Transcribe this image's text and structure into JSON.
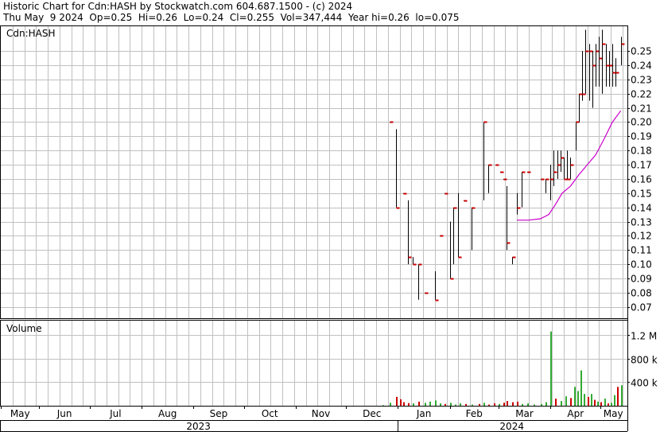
{
  "header": {
    "line1": "Historic Chart for Cdn:HASH by Stockwatch.com 604.687.1500 - (c) 2024",
    "line2": "Thu May  9 2024  Op=0.25  Hi=0.26  Lo=0.24  Cl=0.255  Vol=347,444  Year hi=0.26  lo=0.075"
  },
  "colors": {
    "background": "#ffffff",
    "grid": "#c0c0c0",
    "frame": "#000000",
    "bar_up": "#000000",
    "bar_close_tick": "#cc0000",
    "moving_average": "#cc00cc",
    "volume_up": "#33aa33",
    "volume_down": "#cc0000"
  },
  "chart_data": [
    {
      "type": "ohlc",
      "title": "Cdn:HASH",
      "y_ticks": [
        "0.25",
        "0.24",
        "0.23",
        "0.22",
        "0.21",
        "0.20",
        "0.19",
        "0.18",
        "0.17",
        "0.16",
        "0.15",
        "0.14",
        "0.13",
        "0.12",
        "0.11",
        "0.10",
        "0.09",
        "0.08",
        "0.07"
      ],
      "ylim": [
        0.062,
        0.268
      ],
      "x_labels": [
        "May",
        "Jun",
        "Jul",
        "Aug",
        "Sep",
        "Oct",
        "Nov",
        "Dec",
        "Jan",
        "Feb",
        "Mar",
        "Apr",
        "May"
      ],
      "year_labels": [
        "2023",
        "2024"
      ],
      "grid": true,
      "legend": "none",
      "ohlc": [
        {
          "d": 232,
          "h": 0.2,
          "l": 0.2,
          "c": 0.2
        },
        {
          "d": 236,
          "h": 0.195,
          "l": 0.14,
          "c": 0.14
        },
        {
          "d": 240,
          "h": 0.15,
          "l": 0.15,
          "c": 0.15
        },
        {
          "d": 243,
          "h": 0.145,
          "l": 0.1,
          "c": 0.105
        },
        {
          "d": 246,
          "h": 0.105,
          "l": 0.1,
          "c": 0.1
        },
        {
          "d": 249,
          "h": 0.1,
          "l": 0.075,
          "c": 0.1
        },
        {
          "d": 253,
          "h": 0.08,
          "l": 0.08,
          "c": 0.08
        },
        {
          "d": 259,
          "h": 0.095,
          "l": 0.075,
          "c": 0.075
        },
        {
          "d": 262,
          "h": 0.12,
          "l": 0.12,
          "c": 0.12
        },
        {
          "d": 265,
          "h": 0.15,
          "l": 0.15,
          "c": 0.15
        },
        {
          "d": 268,
          "h": 0.13,
          "l": 0.09,
          "c": 0.09
        },
        {
          "d": 270,
          "h": 0.14,
          "l": 0.1,
          "c": 0.14
        },
        {
          "d": 273,
          "h": 0.15,
          "l": 0.105,
          "c": 0.105
        },
        {
          "d": 276,
          "h": 0.145,
          "l": 0.145,
          "c": 0.145
        },
        {
          "d": 281,
          "h": 0.14,
          "l": 0.11,
          "c": 0.14
        },
        {
          "d": 288,
          "h": 0.2,
          "l": 0.145,
          "c": 0.2
        },
        {
          "d": 291,
          "h": 0.17,
          "l": 0.15,
          "c": 0.17
        },
        {
          "d": 295,
          "h": 0.17,
          "l": 0.17,
          "c": 0.17
        },
        {
          "d": 298,
          "h": 0.165,
          "l": 0.165,
          "c": 0.165
        },
        {
          "d": 300,
          "h": 0.16,
          "l": 0.16,
          "c": 0.16
        },
        {
          "d": 302,
          "h": 0.155,
          "l": 0.11,
          "c": 0.115
        },
        {
          "d": 305,
          "h": 0.105,
          "l": 0.1,
          "c": 0.105
        },
        {
          "d": 308,
          "h": 0.15,
          "l": 0.135,
          "c": 0.14
        },
        {
          "d": 311,
          "h": 0.165,
          "l": 0.14,
          "c": 0.165
        },
        {
          "d": 314,
          "h": 0.165,
          "l": 0.165,
          "c": 0.165
        },
        {
          "d": 322,
          "h": 0.16,
          "l": 0.16,
          "c": 0.16
        },
        {
          "d": 325,
          "h": 0.16,
          "l": 0.15,
          "c": 0.16
        },
        {
          "d": 328,
          "h": 0.17,
          "l": 0.145,
          "c": 0.16
        },
        {
          "d": 330,
          "h": 0.18,
          "l": 0.155,
          "c": 0.165
        },
        {
          "d": 332,
          "h": 0.18,
          "l": 0.16,
          "c": 0.17
        },
        {
          "d": 334,
          "h": 0.18,
          "l": 0.165,
          "c": 0.175
        },
        {
          "d": 336,
          "h": 0.175,
          "l": 0.16,
          "c": 0.16
        },
        {
          "d": 338,
          "h": 0.18,
          "l": 0.16,
          "c": 0.16
        },
        {
          "d": 340,
          "h": 0.175,
          "l": 0.16,
          "c": 0.17
        },
        {
          "d": 343,
          "h": 0.2,
          "l": 0.18,
          "c": 0.2
        },
        {
          "d": 345,
          "h": 0.22,
          "l": 0.2,
          "c": 0.22
        },
        {
          "d": 347,
          "h": 0.25,
          "l": 0.215,
          "c": 0.22
        },
        {
          "d": 349,
          "h": 0.265,
          "l": 0.22,
          "c": 0.25
        },
        {
          "d": 351,
          "h": 0.255,
          "l": 0.215,
          "c": 0.25
        },
        {
          "d": 353,
          "h": 0.25,
          "l": 0.21,
          "c": 0.24
        },
        {
          "d": 355,
          "h": 0.255,
          "l": 0.225,
          "c": 0.25
        },
        {
          "d": 357,
          "h": 0.26,
          "l": 0.225,
          "c": 0.245
        },
        {
          "d": 359,
          "h": 0.265,
          "l": 0.22,
          "c": 0.255
        },
        {
          "d": 361,
          "h": 0.255,
          "l": 0.225,
          "c": 0.24
        },
        {
          "d": 363,
          "h": 0.25,
          "l": 0.225,
          "c": 0.24
        },
        {
          "d": 365,
          "h": 0.255,
          "l": 0.225,
          "c": 0.235
        },
        {
          "d": 367,
          "h": 0.245,
          "l": 0.225,
          "c": 0.235
        },
        {
          "d": 370,
          "h": 0.26,
          "l": 0.24,
          "c": 0.255
        }
      ],
      "moving_average": [
        {
          "d": 308,
          "v": 0.131
        },
        {
          "d": 315,
          "v": 0.131
        },
        {
          "d": 322,
          "v": 0.132
        },
        {
          "d": 327,
          "v": 0.135
        },
        {
          "d": 331,
          "v": 0.142
        },
        {
          "d": 335,
          "v": 0.15
        },
        {
          "d": 340,
          "v": 0.155
        },
        {
          "d": 345,
          "v": 0.163
        },
        {
          "d": 350,
          "v": 0.17
        },
        {
          "d": 355,
          "v": 0.177
        },
        {
          "d": 360,
          "v": 0.188
        },
        {
          "d": 365,
          "v": 0.2
        },
        {
          "d": 370,
          "v": 0.208
        }
      ]
    },
    {
      "type": "bar",
      "title": "Volume",
      "y_ticks": [
        "1.2 M",
        "800 k",
        "400 k"
      ],
      "ylim": [
        0,
        1350000
      ],
      "grid": true,
      "volume": [
        {
          "d": 228,
          "v": 10000,
          "dir": "up"
        },
        {
          "d": 232,
          "v": 50000,
          "dir": "up"
        },
        {
          "d": 236,
          "v": 150000,
          "dir": "down"
        },
        {
          "d": 238,
          "v": 110000,
          "dir": "down"
        },
        {
          "d": 240,
          "v": 60000,
          "dir": "down"
        },
        {
          "d": 243,
          "v": 45000,
          "dir": "down"
        },
        {
          "d": 246,
          "v": 40000,
          "dir": "up"
        },
        {
          "d": 249,
          "v": 70000,
          "dir": "down"
        },
        {
          "d": 253,
          "v": 50000,
          "dir": "up"
        },
        {
          "d": 256,
          "v": 70000,
          "dir": "up"
        },
        {
          "d": 259,
          "v": 90000,
          "dir": "up"
        },
        {
          "d": 262,
          "v": 40000,
          "dir": "up"
        },
        {
          "d": 265,
          "v": 30000,
          "dir": "down"
        },
        {
          "d": 268,
          "v": 50000,
          "dir": "up"
        },
        {
          "d": 271,
          "v": 20000,
          "dir": "up"
        },
        {
          "d": 274,
          "v": 40000,
          "dir": "up"
        },
        {
          "d": 277,
          "v": 30000,
          "dir": "down"
        },
        {
          "d": 281,
          "v": 20000,
          "dir": "up"
        },
        {
          "d": 285,
          "v": 30000,
          "dir": "down"
        },
        {
          "d": 288,
          "v": 50000,
          "dir": "up"
        },
        {
          "d": 291,
          "v": 20000,
          "dir": "down"
        },
        {
          "d": 294,
          "v": 40000,
          "dir": "down"
        },
        {
          "d": 297,
          "v": 30000,
          "dir": "up"
        },
        {
          "d": 300,
          "v": 50000,
          "dir": "down"
        },
        {
          "d": 302,
          "v": 80000,
          "dir": "down"
        },
        {
          "d": 305,
          "v": 60000,
          "dir": "down"
        },
        {
          "d": 308,
          "v": 70000,
          "dir": "down"
        },
        {
          "d": 311,
          "v": 30000,
          "dir": "up"
        },
        {
          "d": 314,
          "v": 40000,
          "dir": "up"
        },
        {
          "d": 318,
          "v": 20000,
          "dir": "up"
        },
        {
          "d": 322,
          "v": 30000,
          "dir": "up"
        },
        {
          "d": 325,
          "v": 60000,
          "dir": "up"
        },
        {
          "d": 328,
          "v": 1260000,
          "dir": "up"
        },
        {
          "d": 331,
          "v": 120000,
          "dir": "down"
        },
        {
          "d": 334,
          "v": 80000,
          "dir": "up"
        },
        {
          "d": 337,
          "v": 160000,
          "dir": "up"
        },
        {
          "d": 340,
          "v": 130000,
          "dir": "down"
        },
        {
          "d": 342,
          "v": 320000,
          "dir": "up"
        },
        {
          "d": 344,
          "v": 250000,
          "dir": "up"
        },
        {
          "d": 346,
          "v": 600000,
          "dir": "up"
        },
        {
          "d": 348,
          "v": 200000,
          "dir": "up"
        },
        {
          "d": 350,
          "v": 150000,
          "dir": "down"
        },
        {
          "d": 352,
          "v": 200000,
          "dir": "up"
        },
        {
          "d": 354,
          "v": 100000,
          "dir": "down"
        },
        {
          "d": 356,
          "v": 70000,
          "dir": "up"
        },
        {
          "d": 358,
          "v": 60000,
          "dir": "down"
        },
        {
          "d": 360,
          "v": 120000,
          "dir": "up"
        },
        {
          "d": 362,
          "v": 40000,
          "dir": "down"
        },
        {
          "d": 364,
          "v": 50000,
          "dir": "up"
        },
        {
          "d": 366,
          "v": 180000,
          "dir": "up"
        },
        {
          "d": 368,
          "v": 320000,
          "dir": "down"
        },
        {
          "d": 370,
          "v": 347444,
          "dir": "up"
        }
      ]
    }
  ]
}
